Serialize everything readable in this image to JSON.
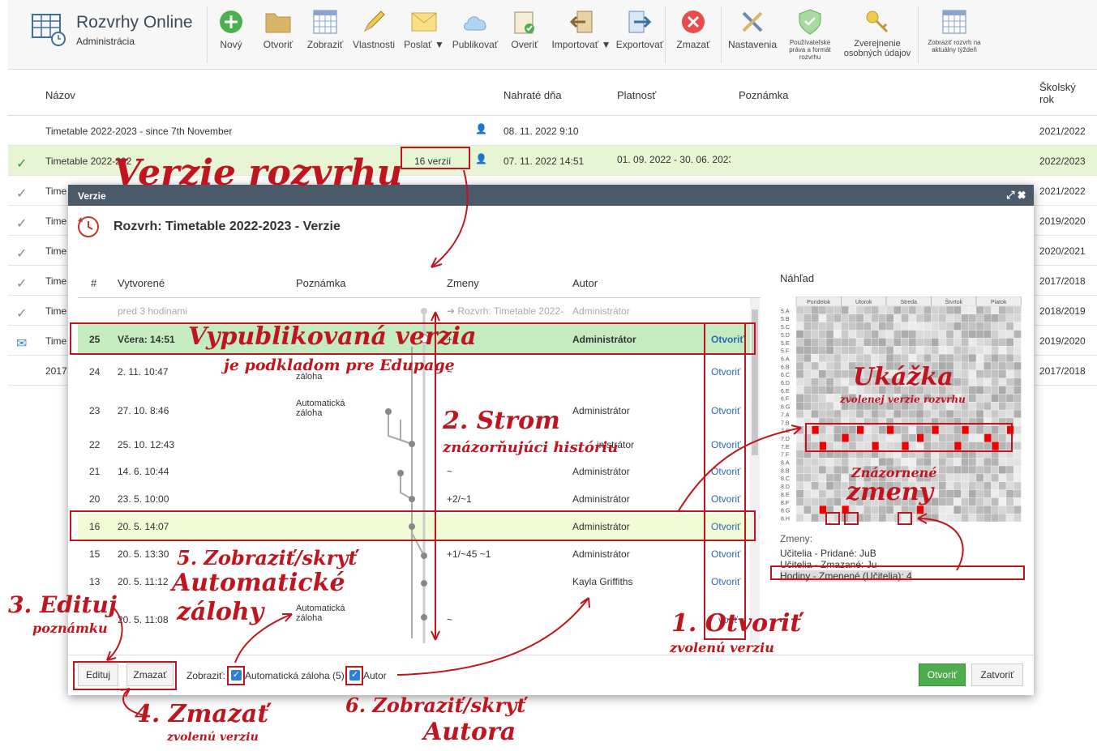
{
  "app": {
    "title": "Rozvrhy Online",
    "subtitle": "Administrácia"
  },
  "toolbar": [
    {
      "label": "Nový",
      "icon": "plus-icon"
    },
    {
      "label": "Otvoriť",
      "icon": "folder-icon"
    },
    {
      "label": "Zobraziť",
      "icon": "grid-icon"
    },
    {
      "label": "Vlastnosti",
      "icon": "pencil-icon"
    },
    {
      "label": "Poslať ▼",
      "icon": "envelope-icon"
    },
    {
      "label": "Publikovať",
      "icon": "cloud-icon"
    },
    {
      "label": "Overiť",
      "icon": "clipboard-check-icon"
    },
    {
      "label": "Importovať ▼",
      "icon": "import-icon"
    },
    {
      "label": "Exportovať",
      "icon": "export-icon"
    },
    {
      "label": "Zmazať",
      "icon": "delete-icon"
    },
    {
      "label": "Nastavenia",
      "icon": "tools-icon"
    },
    {
      "label": "Používateľské práva a formát rozvrhu",
      "icon": "shield-icon"
    },
    {
      "label": "Zverejnenie osobných údajov",
      "icon": "key-icon"
    },
    {
      "label": "Zobraziť rozvrh na aktuálny týždeň",
      "icon": "calendar-icon"
    }
  ],
  "grid": {
    "headers": {
      "name": "Názov",
      "uploaded": "Nahraté dňa",
      "validity": "Platnosť",
      "note": "Poznámka",
      "year": "Školský rok"
    },
    "rows": [
      {
        "name": "Timetable 2022-2023 - since 7th November",
        "uploaded": "08. 11. 2022 9:10",
        "validity": "",
        "year": "2021/2022",
        "status": ""
      },
      {
        "name": "Timetable 2022-202",
        "versions": "16 verzií",
        "uploaded": "07. 11. 2022 14:51",
        "validity": "01. 09. 2022 - 30. 06. 2023",
        "year": "2022/2023",
        "status": "check-green"
      },
      {
        "name": "Time",
        "year": "2021/2022",
        "status": "check"
      },
      {
        "name": "Time",
        "year": "2019/2020",
        "status": "check"
      },
      {
        "name": "Time",
        "year": "2020/2021",
        "status": "check"
      },
      {
        "name": "Time",
        "year": "2017/2018",
        "status": "check"
      },
      {
        "name": "Time",
        "year": "2018/2019",
        "status": "check"
      },
      {
        "name": "Time",
        "year": "2019/2020",
        "status": "mail"
      },
      {
        "name": "2017",
        "year": "2017/2018",
        "status": ""
      }
    ]
  },
  "dialog": {
    "title": "Verzie",
    "heading": "Rozvrh: Timetable 2022-2023 - Verzie",
    "columns": {
      "num": "#",
      "created": "Vytvorené",
      "note": "Poznámka",
      "changes": "Zmeny",
      "author": "Autor"
    },
    "top_row": {
      "created": "pred 3 hodinami",
      "changes": "➔ Rozvrh: Timetable 2022-",
      "author": "Administrátor"
    },
    "rows": [
      {
        "num": "25",
        "created": "Včera: 14:51",
        "note": "",
        "changes": "+1",
        "author": "Administrátor",
        "open": "Otvoriť"
      },
      {
        "num": "24",
        "created": "2. 11. 10:47",
        "note": "záloha",
        "changes": "~",
        "author": "",
        "open": "Otvoriť"
      },
      {
        "num": "23",
        "created": "27. 10. 8:46",
        "note": "Automatická záloha",
        "changes": "",
        "author": "Administrátor",
        "open": "Otvoriť"
      },
      {
        "num": "22",
        "created": "25. 10. 12:43",
        "note": "",
        "changes": "",
        "author": "inistrátor",
        "open": "Otvoriť"
      },
      {
        "num": "21",
        "created": "14. 6. 10:44",
        "note": "",
        "changes": "~",
        "author": "Administrátor",
        "open": "Otvoriť"
      },
      {
        "num": "20",
        "created": "23. 5. 10:00",
        "note": "",
        "changes": "+2/~1",
        "author": "Administrátor",
        "open": "Otvoriť"
      },
      {
        "num": "16",
        "created": "20. 5. 14:07",
        "note": "",
        "changes": "",
        "author": "Administrátor",
        "open": "Otvoriť"
      },
      {
        "num": "15",
        "created": "20. 5. 13:30",
        "note": "",
        "changes": "+1/~45 ~1",
        "author": "Administrátor",
        "open": "Otvoriť"
      },
      {
        "num": "13",
        "created": "20. 5. 11:12",
        "note": "",
        "changes": "",
        "author": "Kayla Griffiths",
        "open": "Otvoriť"
      },
      {
        "num": "",
        "created": "20. 5. 11:08",
        "note": "Automatická záloha",
        "changes": "~",
        "author": "",
        "open": "voriť"
      }
    ],
    "preview": {
      "title": "Náhľad",
      "days": [
        "Pondelok",
        "Utorok",
        "Streda",
        "Štvrtok",
        "Piatok"
      ],
      "classes": [
        "5.A",
        "5.B",
        "5.C",
        "5.D",
        "5.E",
        "5.F",
        "6.A",
        "6.B",
        "6.C",
        "6.D",
        "6.E",
        "6.F",
        "6.G",
        "7.A",
        "7.B",
        "7.C",
        "7.D",
        "7.E",
        "7.F",
        "8.A",
        "8.B",
        "8.C",
        "8.D",
        "8.E",
        "8.F",
        "8.G",
        "8.H"
      ],
      "changes_title": "Zmeny:",
      "changes": [
        "Učitelia - Pridané: JuB",
        "Učitelia - Zmazané: Ju",
        "Hodiny - Zmenené (Učitelia): 4"
      ]
    },
    "footer": {
      "edit": "Edituj",
      "delete": "Zmazať",
      "show_label": "Zobraziť:",
      "auto_backup": "Automatická záloha (5)",
      "author": "Autor",
      "open": "Otvoriť",
      "close": "Zatvoriť"
    }
  },
  "annotations": {
    "a1": "Verzie rozvrhu",
    "a2": "Vypublikovaná verzia",
    "a2b": "je podkladom pre Edupage",
    "a3": "Ukážka",
    "a3b": "zvolenej verzie rozvrhu",
    "a4": "2. Strom",
    "a4b": "znázorňujúci históriu",
    "a5": "Znázornené",
    "a5b": "zmeny",
    "a6": "5. Zobraziť/skryť",
    "a6b": "Automatické",
    "a6c": "zálohy",
    "a7": "3. Edituj",
    "a7b": "poznámku",
    "a8": "1. Otvoriť",
    "a8b": "zvolenú verziu",
    "a9": "4. Zmazať",
    "a9b": "zvolenú verziu",
    "a10": "6. Zobraziť/skryť",
    "a10b": "Autora"
  },
  "colors": {
    "accent_red": "#c0141e",
    "selected_green": "#c5ecc0",
    "highlight_yellow": "#f1fbd6",
    "dialog_title": "#4a5a68",
    "open_button": "#4cae4c"
  }
}
